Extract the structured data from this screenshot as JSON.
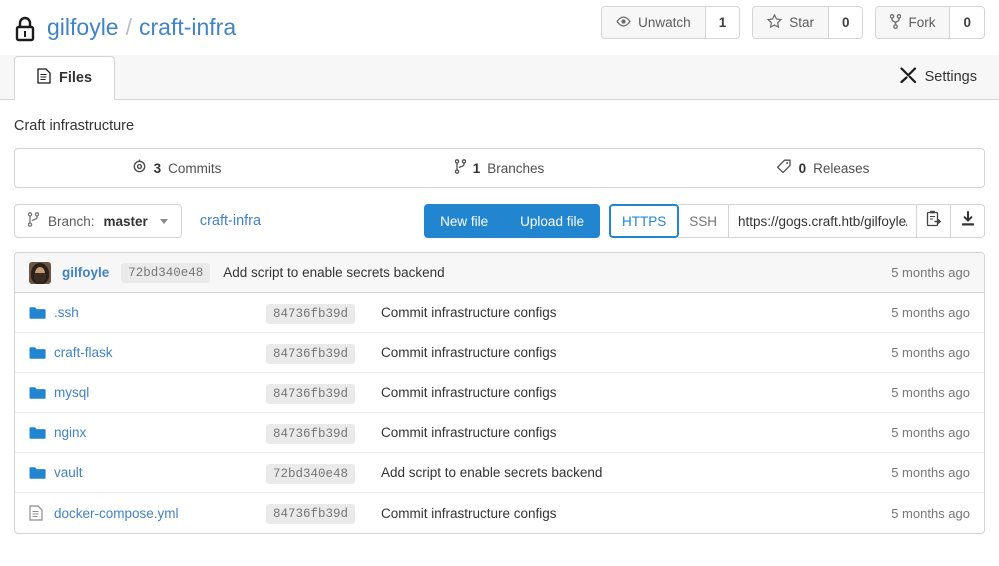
{
  "header": {
    "visibility_icon": "lock-icon",
    "owner": "gilfoyle",
    "separator": "/",
    "repo": "craft-infra",
    "actions": [
      {
        "icon": "eye-icon",
        "label": "Unwatch",
        "count": "1"
      },
      {
        "icon": "star-icon",
        "label": "Star",
        "count": "0"
      },
      {
        "icon": "fork-icon",
        "label": "Fork",
        "count": "0"
      }
    ]
  },
  "tabs": {
    "active": {
      "icon": "file-text-icon",
      "label": "Files"
    },
    "settings": {
      "icon": "tools-icon",
      "label": "Settings"
    }
  },
  "description": "Craft infrastructure",
  "stats": [
    {
      "icon": "commit-icon",
      "count": "3",
      "label": "Commits"
    },
    {
      "icon": "branch-icon",
      "count": "1",
      "label": "Branches"
    },
    {
      "icon": "tag-icon",
      "count": "0",
      "label": "Releases"
    }
  ],
  "toolbar": {
    "branch_icon": "branch-icon",
    "branch_prefix": "Branch:",
    "branch_name": "master",
    "path": "craft-infra",
    "new_file": "New file",
    "upload_file": "Upload file",
    "proto_https": "HTTPS",
    "proto_ssh": "SSH",
    "clone_url": "https://gogs.craft.htb/gilfoyle/craft-infra.git",
    "copy_icon": "clipboard-copy-icon",
    "download_icon": "download-icon"
  },
  "latest_commit": {
    "avatar": "avatar",
    "author": "gilfoyle",
    "sha": "72bd340e48",
    "message": "Add script to enable secrets backend",
    "age": "5 months ago"
  },
  "files": [
    {
      "type": "folder",
      "icon": "folder-icon",
      "name": ".ssh",
      "sha": "84736fb39d",
      "message": "Commit infrastructure configs",
      "age": "5 months ago"
    },
    {
      "type": "folder",
      "icon": "folder-icon",
      "name": "craft-flask",
      "sha": "84736fb39d",
      "message": "Commit infrastructure configs",
      "age": "5 months ago"
    },
    {
      "type": "folder",
      "icon": "folder-icon",
      "name": "mysql",
      "sha": "84736fb39d",
      "message": "Commit infrastructure configs",
      "age": "5 months ago"
    },
    {
      "type": "folder",
      "icon": "folder-icon",
      "name": "nginx",
      "sha": "84736fb39d",
      "message": "Commit infrastructure configs",
      "age": "5 months ago"
    },
    {
      "type": "folder",
      "icon": "folder-icon",
      "name": "vault",
      "sha": "72bd340e48",
      "message": "Add script to enable secrets backend",
      "age": "5 months ago"
    },
    {
      "type": "file",
      "icon": "file-icon",
      "name": "docker-compose.yml",
      "sha": "84736fb39d",
      "message": "Commit infrastructure configs",
      "age": "5 months ago"
    }
  ],
  "colors": {
    "link": "#4183c4",
    "primary": "#2185d0",
    "folder": "#2185d0",
    "border": "#d4d4d5"
  }
}
